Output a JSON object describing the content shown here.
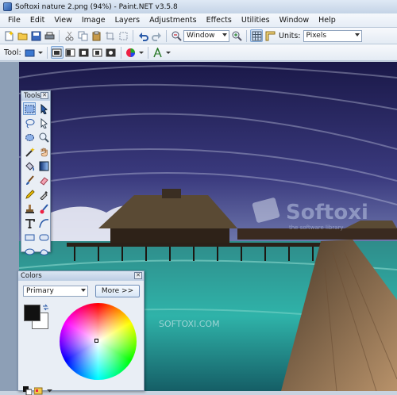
{
  "window": {
    "title": "Softoxi nature 2.png (94%) - Paint.NET v3.5.8"
  },
  "menu": [
    "File",
    "Edit",
    "View",
    "Image",
    "Layers",
    "Adjustments",
    "Effects",
    "Utilities",
    "Window",
    "Help"
  ],
  "toolbar": {
    "zoom_value": "Window",
    "units_label": "Units:",
    "units_value": "Pixels",
    "tool_label": "Tool:"
  },
  "tools_panel": {
    "title": "Tools"
  },
  "colors_panel": {
    "title": "Colors",
    "mode_value": "Primary",
    "more_button": "More >>",
    "primary_color": "#111111",
    "secondary_color": "#ffffff"
  },
  "canvas": {
    "watermark_logo": "Softoxi",
    "watermark_tagline": "the software library",
    "watermark_text": "SOFTOXI.COM"
  },
  "colors": {
    "accent": "#2a5aa8",
    "sky": "#3a3a7a"
  }
}
